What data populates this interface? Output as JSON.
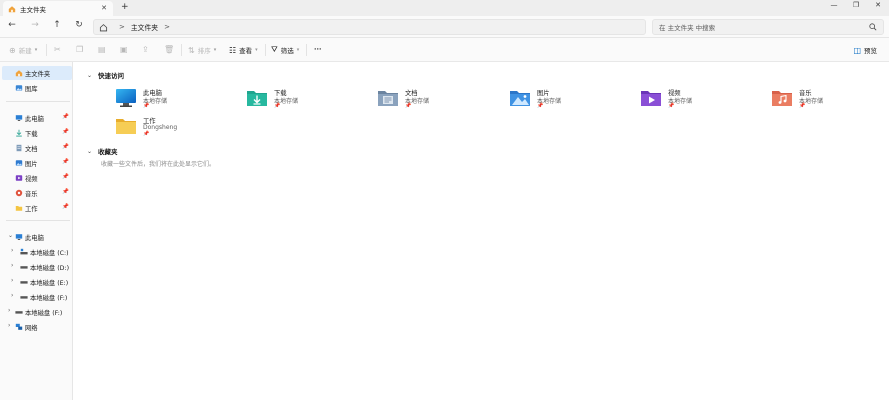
{
  "titlebar": {
    "tab_title": "主文件夹",
    "tab_close": "✕",
    "new_tab": "+",
    "minimize": "—",
    "maximize": "❐",
    "close": "✕"
  },
  "nav": {
    "back": "←",
    "forward": "→",
    "up": "↑",
    "refresh": "↻",
    "expand": "▭",
    "breadcrumb_sep": ">",
    "breadcrumb": "主文件夹",
    "search_placeholder": "在 主文件夹 中搜索"
  },
  "command_bar": {
    "new_label": "新建",
    "sort_label": "排序",
    "view_label": "查看",
    "filter_label": "筛选",
    "more_label": "···",
    "preview_label": "预览"
  },
  "sidebar": {
    "home": "主文件夹",
    "gallery": "图库",
    "quick": [
      {
        "label": "此电脑"
      },
      {
        "label": "下载"
      },
      {
        "label": "文档"
      },
      {
        "label": "图片"
      },
      {
        "label": "视频"
      },
      {
        "label": "音乐"
      },
      {
        "label": "工作"
      }
    ],
    "thispc": "此电脑",
    "drives": [
      {
        "label": "本地磁盘 (C:)"
      },
      {
        "label": "本地磁盘 (D:)"
      },
      {
        "label": "本地磁盘 (E:)"
      },
      {
        "label": "本地磁盘 (F:)"
      }
    ],
    "ext_drive": "本地磁盘 (F:)",
    "network": "网络"
  },
  "main": {
    "quick_access_title": "快速访问",
    "favorites_title": "收藏夹",
    "favorites_empty": "收藏一些文件后，我们将在此处显示它们。",
    "quick_items": [
      {
        "name": "此电脑",
        "sub": "本地存储",
        "icon": "computer-icon"
      },
      {
        "name": "下载",
        "sub": "本地存储",
        "icon": "downloads-folder-icon"
      },
      {
        "name": "文档",
        "sub": "本地存储",
        "icon": "documents-folder-icon"
      },
      {
        "name": "图片",
        "sub": "本地存储",
        "icon": "pictures-folder-icon"
      },
      {
        "name": "视频",
        "sub": "本地存储",
        "icon": "videos-folder-icon"
      },
      {
        "name": "音乐",
        "sub": "本地存储",
        "icon": "music-folder-icon"
      },
      {
        "name": "工作",
        "sub": "Dongsheng",
        "icon": "folder-icon"
      }
    ]
  },
  "colors": {
    "accent": "#0067c0",
    "selection": "#dcebfb",
    "folder_yellow": "#f4c542"
  }
}
